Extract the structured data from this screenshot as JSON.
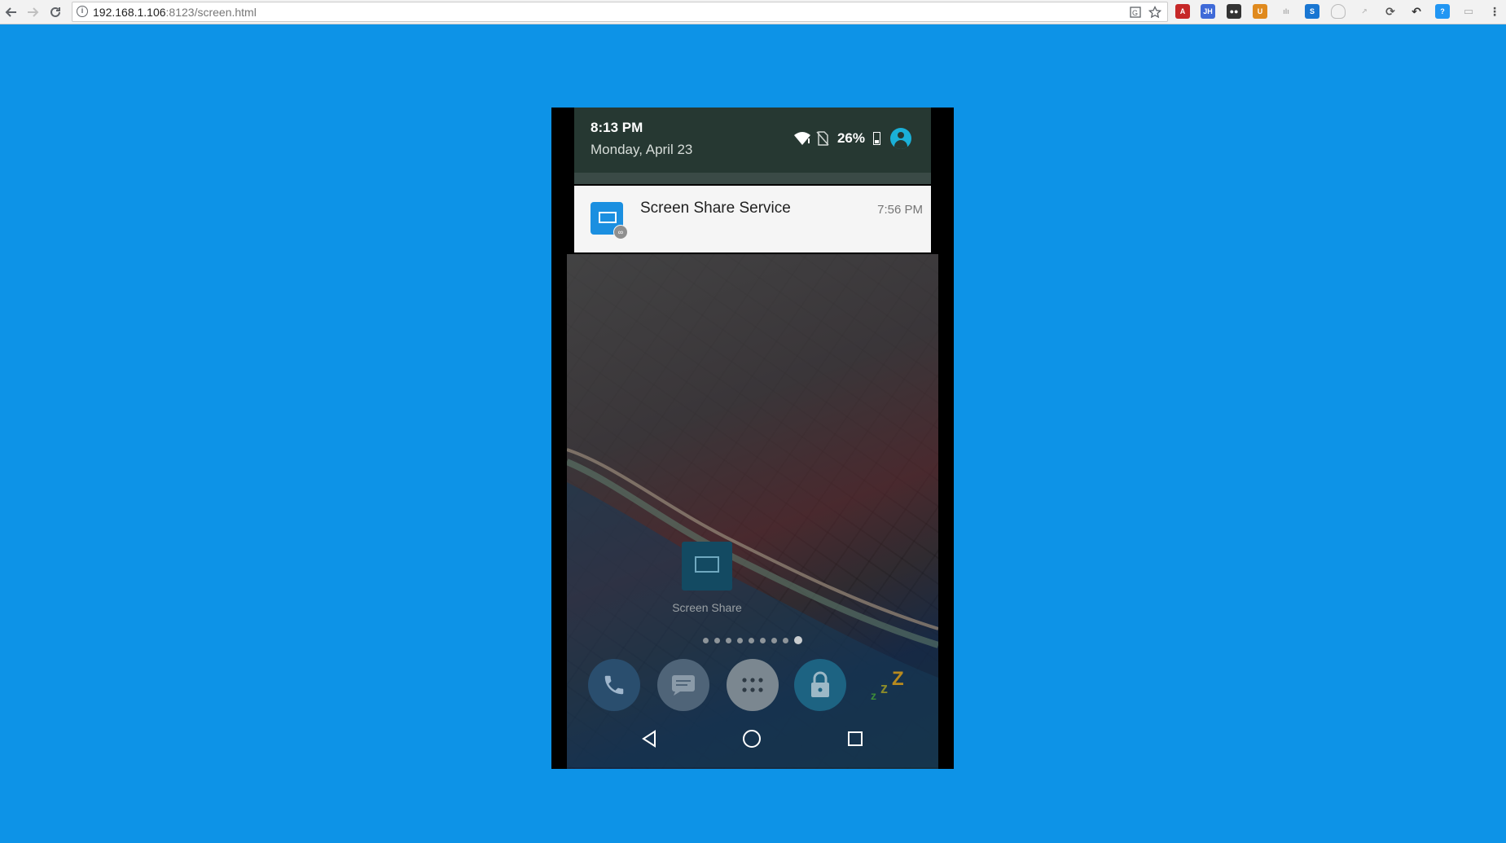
{
  "browser": {
    "url_host": "192.168.1.106",
    "url_rest": ":8123/screen.html",
    "extensions": [
      "translate-icon",
      "star-icon",
      "acrobat-icon",
      "jh-icon",
      "incognito-icon",
      "extension-icon",
      "generic-icon",
      "screen-icon",
      "shield-icon",
      "cursor-icon",
      "sync-icon",
      "arrow-icon",
      "doc-icon",
      "chat-icon",
      "menu-icon"
    ]
  },
  "phone": {
    "status": {
      "time": "8:13 PM",
      "date": "Monday, April 23",
      "battery": "26%"
    },
    "notification": {
      "title": "Screen Share Service",
      "time": "7:56 PM",
      "badge": "∞"
    },
    "home": {
      "app_label": "Screen Share",
      "page_count": 9,
      "active_page": 9
    },
    "dock": [
      "phone-icon",
      "messages-icon",
      "app-drawer-icon",
      "lock-icon",
      "sleep-icon"
    ],
    "nav": [
      "back-icon",
      "home-icon",
      "recents-icon"
    ]
  },
  "colors": {
    "background": "#0d93e7",
    "notification_icon": "#1b8fe0",
    "status_header": "#263832"
  }
}
